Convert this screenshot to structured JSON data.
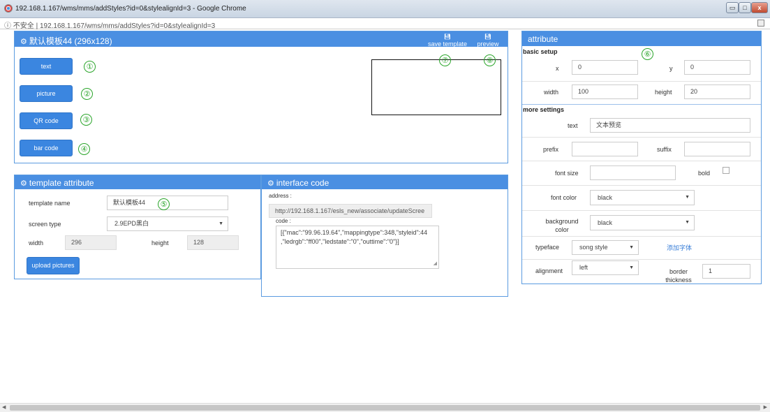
{
  "window": {
    "title": "192.168.1.167/wms/mms/addStyles?id=0&stylealignId=3 - Google Chrome",
    "controls": [
      "▭",
      "□",
      "x"
    ]
  },
  "addressbar": {
    "security": "不安全",
    "url": "192.168.1.167/wms/mms/addStyles?id=0&stylealignId=3"
  },
  "editor": {
    "title": "默认模板44 (296x128)",
    "save_label": "save template",
    "preview_label": "preview",
    "tools": [
      "text",
      "picture",
      "QR code",
      "bar code"
    ],
    "markers": [
      "①",
      "②",
      "③",
      "④",
      "⑤",
      "⑥",
      "⑦",
      "⑧"
    ]
  },
  "template_attribute": {
    "title": "template attribute",
    "name_label": "template name",
    "name_value": "默认模板44",
    "screen_type_label": "screen type",
    "screen_type_value": "2.9EPD黑白",
    "width_label": "width",
    "width_value": "296",
    "height_label": "height",
    "height_value": "128",
    "upload_label": "upload pictures"
  },
  "interface_code": {
    "title": "interface code",
    "address_label": "address :",
    "address_value": "http://192.168.1.167/esls_new/associate/updateScree",
    "code_label": "code :",
    "code_line1": "[{\"mac\":\"99.96.19.64\",\"mappingtype\":348,\"styleid\":44",
    "code_line2": ",\"ledrgb\":\"ff00\",\"ledstate\":\"0\",\"outtime\":\"0\"}]"
  },
  "attribute": {
    "title": "attribute",
    "basic_setup": "basic setup",
    "x_label": "x",
    "x_value": "0",
    "y_label": "y",
    "y_value": "0",
    "width_label": "width",
    "width_value": "100",
    "height_label": "height",
    "height_value": "20",
    "more_settings": "more settings",
    "text_label": "text",
    "text_value": "文本预览",
    "prefix_label": "prefix",
    "prefix_value": "",
    "suffix_label": "suffix",
    "suffix_value": "",
    "font_size_label": "font size",
    "font_size_value": "",
    "bold_label": "bold",
    "font_color_label": "font color",
    "font_color_value": "black",
    "bg_color_label_1": "background",
    "bg_color_label_2": "color",
    "bg_color_value": "black",
    "typeface_label": "typeface",
    "typeface_value": "song style",
    "add_font_link": "添加字体",
    "alignment_label": "alignment",
    "alignment_value": "left",
    "border_label_1": "border",
    "border_label_2": "thickness",
    "border_value": "1"
  },
  "colors": {
    "header_blue": "#4a8fe2",
    "button_blue": "#3b86e0",
    "marker_green": "#2aa52a"
  }
}
